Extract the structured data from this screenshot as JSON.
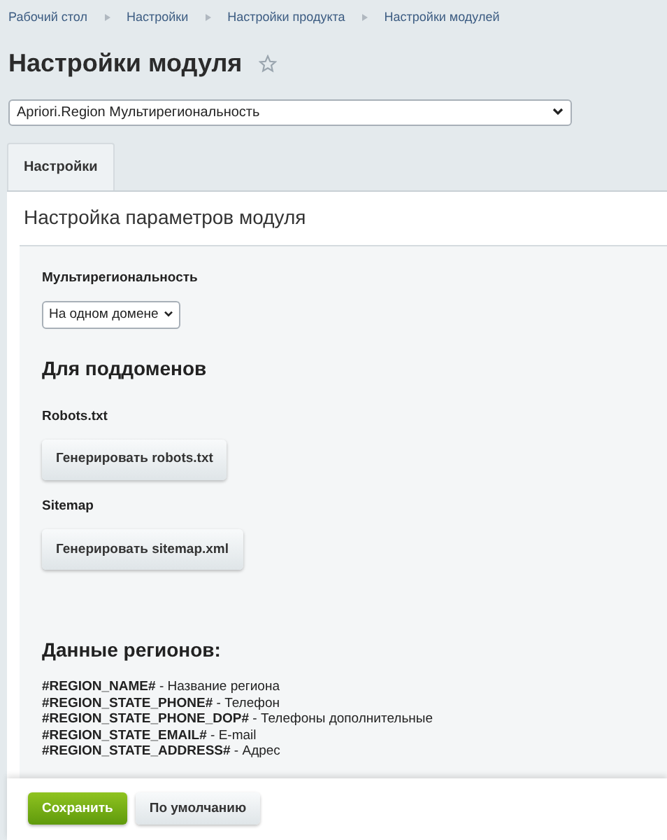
{
  "breadcrumbs": [
    "Рабочий стол",
    "Настройки",
    "Настройки продукта",
    "Настройки модулей"
  ],
  "title": "Настройки модуля",
  "favorite": false,
  "module_select": {
    "value": "Apriori.Region Мультирегиональность"
  },
  "tabs": [
    {
      "label": "Настройки",
      "selected": true
    }
  ],
  "panel_title": "Настройка параметров модуля",
  "multiregion": {
    "label": "Мультирегиональность",
    "value": "На одном домене"
  },
  "subdomains": {
    "heading": "Для поддоменов",
    "robots_label": "Robots.txt",
    "robots_button": "Генерировать robots.txt",
    "sitemap_label": "Sitemap",
    "sitemap_button": "Генерировать sitemap.xml"
  },
  "region_data": {
    "heading": "Данные регионов:",
    "lines": [
      "**#REGION_NAME#** - Название региона",
      "**#REGION_STATE_PHONE#** - Телефон",
      "**#REGION_STATE_PHONE_DOP#** - Телефоны дополнительные",
      "**#REGION_STATE_EMAIL#** - E-mail",
      "**#REGION_STATE_ADDRESS#** - Адрес"
    ]
  },
  "footer_buttons": [
    {
      "label": "Сохранить",
      "kind": "primary"
    },
    {
      "label": "По умолчанию",
      "kind": "secondary"
    }
  ]
}
